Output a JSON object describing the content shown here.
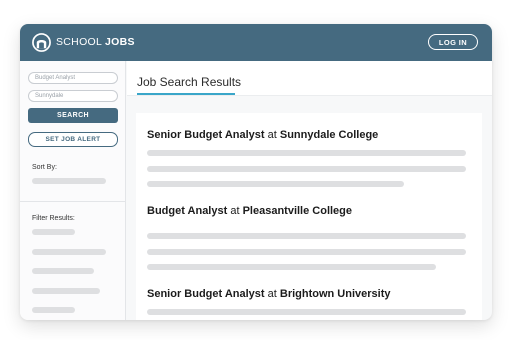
{
  "header": {
    "logo_school": "SCHOOL",
    "logo_jobs": "JOBS",
    "login_label": "LOG IN"
  },
  "sidebar": {
    "keyword_placeholder": "Budget Analyst",
    "location_placeholder": "Sunnydale",
    "search_label": "SEARCH",
    "alert_label": "SET JOB ALERT",
    "sort_label": "Sort By:",
    "filter_label": "Filter Results:"
  },
  "main": {
    "title": "Job Search Results",
    "jobs": [
      {
        "title": "Senior Budget Analyst",
        "at": "at",
        "employer": "Sunnydale College"
      },
      {
        "title": "Budget Analyst",
        "at": "at",
        "employer": "Pleasantville College"
      },
      {
        "title": "Senior Budget Analyst",
        "at": "at",
        "employer": "Brightown University"
      }
    ]
  },
  "colors": {
    "brand": "#456a80",
    "accent": "#3aa6c9",
    "placeholder_bar": "#dedfe1"
  }
}
